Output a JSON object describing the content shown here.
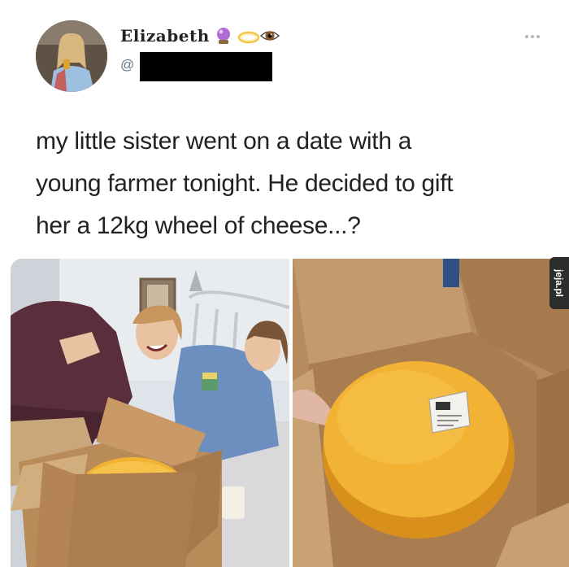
{
  "tweet": {
    "author": {
      "display_name": "Elizabeth",
      "name_emojis": [
        "crystal-ball-icon",
        "halo-icon",
        "eye-icon"
      ],
      "handle_prefix": "@"
    },
    "text_lines": [
      "my little sister went on a date with a",
      "young farmer tonight. He decided to gift",
      "her a 12kg wheel of cheese...?"
    ]
  },
  "watermark": {
    "text": "jeja.pl"
  },
  "colors": {
    "background": "#ffffff",
    "text": "#222222",
    "handle": "#657786",
    "cheese": "#f2b233",
    "cardboard": "#b88b58",
    "redaction": "#000000"
  }
}
